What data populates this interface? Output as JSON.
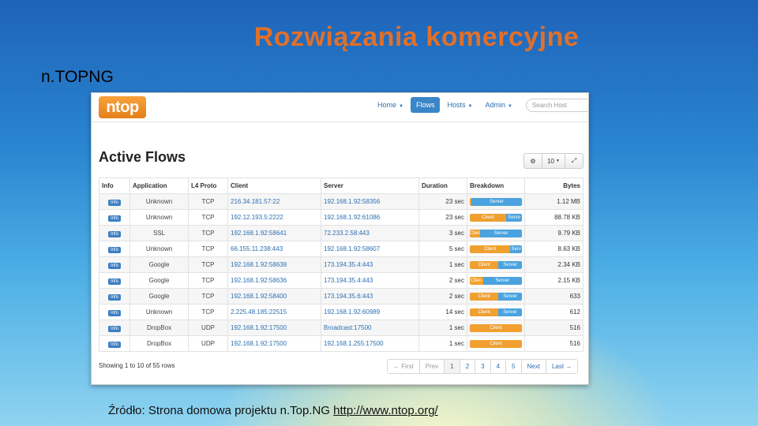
{
  "slide": {
    "title": "Rozwiązania komercyjne",
    "subtitle": "n.TOPNG",
    "source_prefix": "Źródło: Strona domowa projektu n.Top.NG ",
    "source_link": "http://www.ntop.org/"
  },
  "app": {
    "logo": "ntop",
    "nav": [
      {
        "label": "Home",
        "caret": true,
        "active": false
      },
      {
        "label": "Flows",
        "caret": false,
        "active": true
      },
      {
        "label": "Hosts",
        "caret": true,
        "active": false
      },
      {
        "label": "Admin",
        "caret": true,
        "active": false
      }
    ],
    "search_placeholder": "Search Host",
    "page_title": "Active Flows",
    "toolbar": {
      "gear_icon": "gear-icon",
      "page_size": "10",
      "expand_icon": "expand-icon"
    },
    "columns": [
      "Info",
      "Application",
      "L4 Proto",
      "Client",
      "Server",
      "Duration",
      "Breakdown",
      "Bytes"
    ],
    "rows": [
      {
        "info": "Info",
        "app": "Unknown",
        "proto": "TCP",
        "client": "216.34.181.57:22",
        "server": "192.168.1.92:58356",
        "duration": "23 sec",
        "client_pct": 0.03,
        "server_label": "Server",
        "client_label": "",
        "bytes": "1.12 MB"
      },
      {
        "info": "Info",
        "app": "Unknown",
        "proto": "TCP",
        "client": "192.12.193.5:2222",
        "server": "192.168.1.92:61086",
        "duration": "23 sec",
        "client_pct": 0.7,
        "client_label": "Client",
        "server_label": "Serve",
        "bytes": "88.78 KB"
      },
      {
        "info": "Info",
        "app": "SSL",
        "proto": "TCP",
        "client": "192.168.1.92:58641",
        "server": "72.233.2.58:443",
        "duration": "3 sec",
        "client_pct": 0.2,
        "client_label": "Clien",
        "server_label": "Server",
        "bytes": "9.79 KB"
      },
      {
        "info": "Info",
        "app": "Unknown",
        "proto": "TCP",
        "client": "66.155.11.238:443",
        "server": "192.168.1.92:58607",
        "duration": "5 sec",
        "client_pct": 0.78,
        "client_label": "Client",
        "server_label": "Serv",
        "bytes": "8.63 KB"
      },
      {
        "info": "Info",
        "app": "Google",
        "proto": "TCP",
        "client": "192.168.1.92:58638",
        "server": "173.194.35.4:443",
        "duration": "1 sec",
        "client_pct": 0.55,
        "client_label": "Client",
        "server_label": "Server",
        "bytes": "2.34 KB"
      },
      {
        "info": "Info",
        "app": "Google",
        "proto": "TCP",
        "client": "192.168.1.92:58636",
        "server": "173.194.35.4:443",
        "duration": "2 sec",
        "client_pct": 0.25,
        "client_label": "Clien",
        "server_label": "Server",
        "bytes": "2.15 KB"
      },
      {
        "info": "Info",
        "app": "Google",
        "proto": "TCP",
        "client": "192.168.1.92:58400",
        "server": "173.194.35.6:443",
        "duration": "2 sec",
        "client_pct": 0.55,
        "client_label": "Client",
        "server_label": "Server",
        "bytes": "633"
      },
      {
        "info": "Info",
        "app": "Unknown",
        "proto": "TCP",
        "client": "2.225.48.185:22515",
        "server": "192.168.1.92:60989",
        "duration": "14 sec",
        "client_pct": 0.55,
        "client_label": "Client",
        "server_label": "Server",
        "bytes": "612"
      },
      {
        "info": "Info",
        "app": "DropBox",
        "proto": "UDP",
        "client": "192.168.1.92:17500",
        "server": "Broadcast:17500",
        "duration": "1 sec",
        "client_pct": 1.0,
        "client_label": "Client",
        "server_label": "",
        "bytes": "516"
      },
      {
        "info": "Info",
        "app": "DropBox",
        "proto": "UDP",
        "client": "192.168.1.92:17500",
        "server": "192.168.1.255:17500",
        "duration": "1 sec",
        "client_pct": 1.0,
        "client_label": "Client",
        "server_label": "",
        "bytes": "516"
      }
    ],
    "row_count": "Showing 1 to 10 of 55 rows",
    "pagination": [
      "← First",
      "Prev",
      "1",
      "2",
      "3",
      "4",
      "5",
      "Next",
      "Last →"
    ]
  }
}
